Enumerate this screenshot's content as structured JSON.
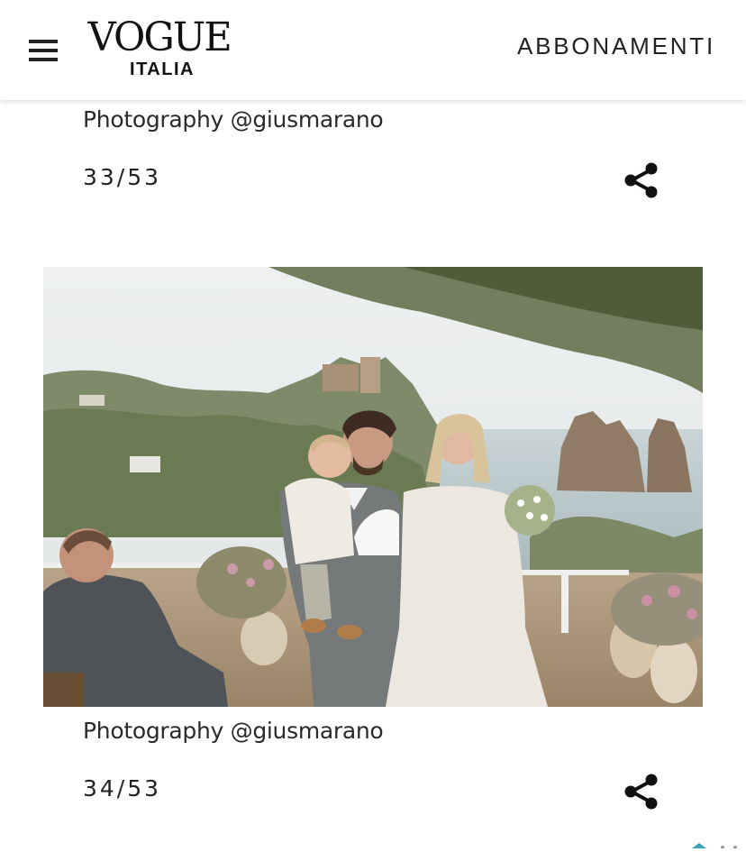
{
  "header": {
    "logo_main": "VOGUE",
    "logo_sub": "ITALIA",
    "subscribe_label": "ABBONAMENTI",
    "menu_icon": "hamburger-menu-icon"
  },
  "slides": [
    {
      "caption": "Photography @giusmarano",
      "counter": "33/53",
      "share_icon": "share-icon"
    },
    {
      "image_alt": "Wedding ceremony: groom holding a baby, bride with bouquet, guest applauding, sea stacks in background",
      "caption": "Photography @giusmarano",
      "counter": "34/53",
      "share_icon": "share-icon"
    }
  ],
  "colors": {
    "text": "#222222",
    "background": "#ffffff"
  }
}
